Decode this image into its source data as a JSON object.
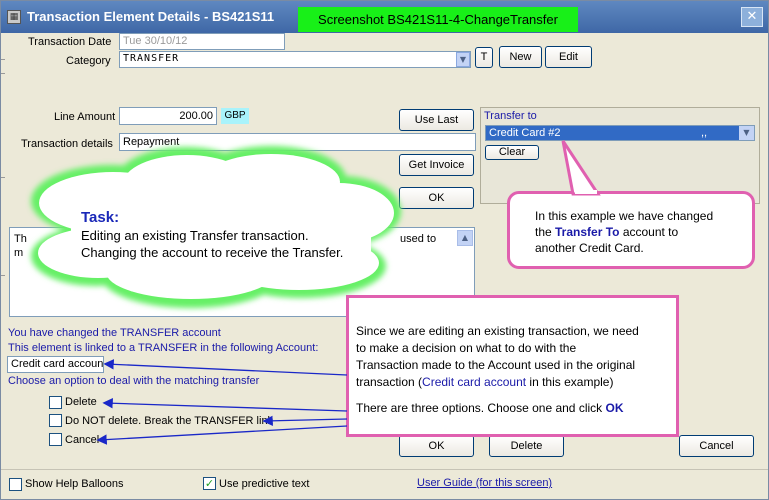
{
  "window": {
    "title": "Transaction Element Details - BS421S11",
    "banner": "Screenshot BS421S11-4-ChangeTransfer",
    "close_glyph": "✕"
  },
  "form": {
    "transaction_date_label": "Transaction Date",
    "transaction_date_value": "Tue 30/10/12",
    "category_label": "Category",
    "category_value": "TRANSFER",
    "t_button": "T",
    "new_button": "New",
    "edit_button": "Edit",
    "line_amount_label": "Line Amount",
    "line_amount_value": "200.00",
    "currency": "GBP",
    "transaction_details_label": "Transaction details",
    "transaction_details_value": "Repayment",
    "use_last_button": "Use Last",
    "get_invoice_button": "Get Invoice",
    "ok_button_upper": "OK",
    "transfer_to_label": "Transfer to",
    "transfer_to_value": "Credit Card #2",
    "transfer_to_suffix": ",,",
    "clear_button": "Clear",
    "memo_partial_left": "Th",
    "memo_partial_left2": "m",
    "memo_partial_right": "used to"
  },
  "linked": {
    "line1": "You have changed the TRANSFER account",
    "line2": "This element is linked to  a TRANSFER in the following Account:",
    "account_value": "Credit card account",
    "line3": "Choose an option to deal with the matching transfer",
    "options": [
      "Delete",
      "Do NOT delete. Break the TRANSFER link",
      "Cancel"
    ]
  },
  "footer": {
    "ok_button": "OK",
    "delete_button": "Delete",
    "cancel_button": "Cancel",
    "show_help_balloons": "Show Help Balloons",
    "use_predictive_text": "Use predictive text",
    "user_guide_link": "User Guide (for this screen)",
    "show_help_checked": false,
    "predictive_checked": true
  },
  "task_cloud": {
    "heading": "Task:",
    "line1": "Editing an existing Transfer transaction.",
    "line2": "Changing the account to receive the Transfer."
  },
  "callout_transfer": {
    "text1": "In this example we have changed",
    "text2_prefix": "the ",
    "text2_highlight": "Transfer To",
    "text2_suffix": " account to",
    "text3": "another Credit Card."
  },
  "callout_options": {
    "line1": "Since we are editing an existing transaction, we need",
    "line2": "to make a decision on what to do with the",
    "line3": "Transaction made to the Account used in the original",
    "line4_prefix": "transaction (",
    "line4_highlight": "Credit card account",
    "line4_suffix": " in this example)",
    "line5_prefix": "There are three options. Choose one and click ",
    "line5_highlight": "OK"
  },
  "colors": {
    "title_bar": "#4a72b0",
    "banner": "#18f018",
    "callout_border": "#e060b0",
    "cloud_glow": "#60f060",
    "annotation_arrow": "#1a28c8",
    "link_blue": "#1a1aa8"
  }
}
